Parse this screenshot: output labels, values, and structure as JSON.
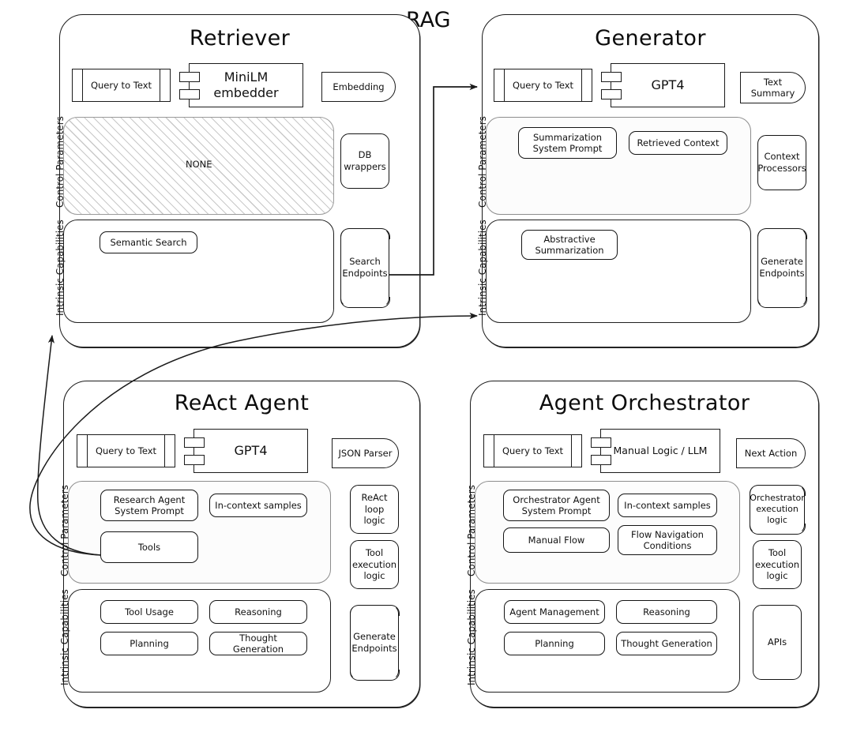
{
  "diagram": {
    "center_title": "RAG",
    "panels": [
      {
        "id": "retriever",
        "title": "Retriever",
        "input": "Query to Text",
        "model": "MiniLM\nembedder",
        "model_line1": "MiniLM",
        "model_line2": "embedder",
        "output": "Embedding",
        "control": {
          "label": "Control Parameters",
          "empty_text": "NONE",
          "items": []
        },
        "capabilities": {
          "label": "Intrinsic Capabilities",
          "items": [
            "Semantic Search"
          ]
        },
        "rail": [
          {
            "line1": "DB",
            "line2": "wrappers",
            "style": "closed"
          },
          {
            "line1": "Search",
            "line2": "Endpoints",
            "style": "open"
          }
        ]
      },
      {
        "id": "generator",
        "title": "Generator",
        "input": "Query to Text",
        "model_line1": "GPT4",
        "model_line2": "",
        "output_line1": "Text",
        "output_line2": "Summary",
        "control": {
          "label": "Control Parameters",
          "items": [
            "Summarization\nSystem Prompt",
            "Retrieved Context"
          ],
          "item_lines": [
            [
              "Summarization",
              "System Prompt"
            ],
            [
              "Retrieved Context",
              ""
            ]
          ]
        },
        "capabilities": {
          "label": "Intrinsic Capabilities",
          "item_lines": [
            [
              "Abstractive",
              "Summarization"
            ]
          ]
        },
        "rail": [
          {
            "line1": "Context",
            "line2": "Processors",
            "style": "closed"
          },
          {
            "line1": "Generate",
            "line2": "Endpoints",
            "style": "open"
          }
        ]
      },
      {
        "id": "react-agent",
        "title": "ReAct Agent",
        "input": "Query to Text",
        "model_line1": "GPT4",
        "output_line1": "JSON Parser",
        "control": {
          "label": "Control Parameters",
          "item_lines": [
            [
              "Research Agent",
              "System Prompt"
            ],
            [
              "In-context samples",
              ""
            ],
            [
              "Tools",
              ""
            ]
          ]
        },
        "capabilities": {
          "label": "Intrinsic Capabilities",
          "item_lines": [
            [
              "Tool Usage",
              ""
            ],
            [
              "Reasoning",
              ""
            ],
            [
              "Planning",
              ""
            ],
            [
              "Thought Generation",
              ""
            ]
          ]
        },
        "rail": [
          {
            "line1": "ReAct",
            "line2": "loop",
            "line3": "logic",
            "style": "closed"
          },
          {
            "line1": "Tool",
            "line2": "execution",
            "line3": "logic",
            "style": "closed"
          },
          {
            "line1": "Generate",
            "line2": "Endpoints",
            "style": "open"
          }
        ]
      },
      {
        "id": "agent-orchestrator",
        "title": "Agent Orchestrator",
        "input": "Query to Text",
        "model_line1": "Manual Logic / LLM",
        "output_line1": "Next Action",
        "control": {
          "label": "Control Parameters",
          "item_lines": [
            [
              "Orchestrator Agent",
              "System Prompt"
            ],
            [
              "In-context samples",
              ""
            ],
            [
              "Manual Flow",
              ""
            ],
            [
              "Flow Navigation",
              "Conditions"
            ]
          ]
        },
        "capabilities": {
          "label": "Intrinsic Capabilities",
          "item_lines": [
            [
              "Agent Management",
              ""
            ],
            [
              "Reasoning",
              ""
            ],
            [
              "Planning",
              ""
            ],
            [
              "Thought Generation",
              ""
            ]
          ]
        },
        "rail": [
          {
            "line1": "Orchestrator",
            "line2": "execution",
            "line3": "logic",
            "style": "open"
          },
          {
            "line1": "Tool",
            "line2": "execution",
            "line3": "logic",
            "style": "closed"
          },
          {
            "line1": "APIs",
            "line2": "",
            "style": "closed"
          }
        ]
      }
    ],
    "connections": [
      {
        "from": "retriever.search-endpoints",
        "to": "generator.query-to-text"
      },
      {
        "from": "react-agent.tools",
        "to": "generator.panel"
      },
      {
        "from": "react-agent.tools",
        "to": "retriever.panel"
      }
    ],
    "colors": {
      "stroke": "#1b1b1b",
      "hatch": "#c9c9c9",
      "background": "#ffffff"
    }
  }
}
